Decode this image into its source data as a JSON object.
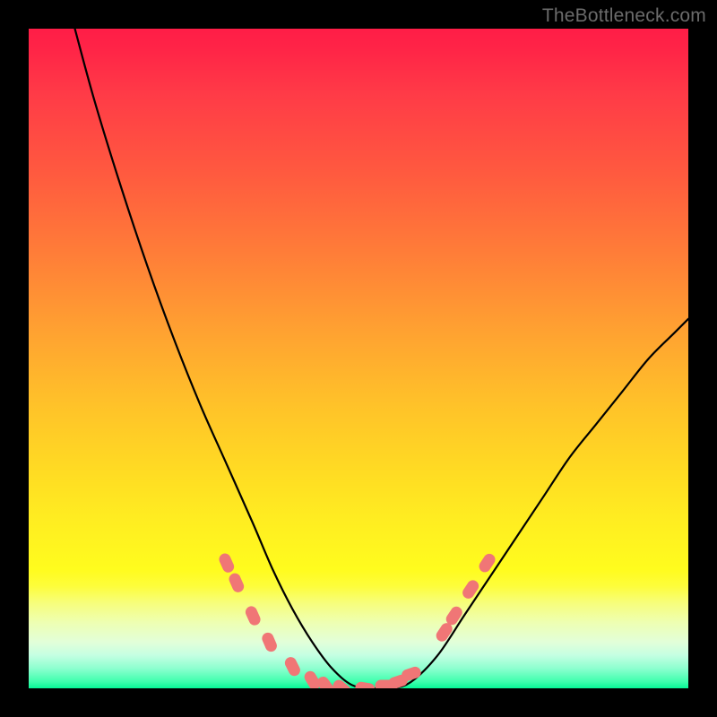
{
  "watermark": "TheBottleneck.com",
  "colors": {
    "curve": "#000000",
    "marker_fill": "#f07676",
    "marker_stroke": "#e86161",
    "gradient_top": "#ff1d47",
    "gradient_bottom": "#06f896",
    "frame": "#000000"
  },
  "chart_data": {
    "type": "line",
    "title": "",
    "xlabel": "",
    "ylabel": "",
    "xlim": [
      0,
      100
    ],
    "ylim": [
      0,
      100
    ],
    "grid": false,
    "note": "Axes are normalized 0–100; x moves left→right, y is 0 at top, 100 at bottom (green). The curve is a V-shaped bottleneck curve touching ~y=100 near x≈46–58.",
    "series": [
      {
        "name": "bottleneck-curve",
        "x": [
          7,
          10,
          14,
          18,
          22,
          26,
          30,
          34,
          37,
          40,
          43,
          46,
          49,
          52,
          55,
          58,
          62,
          66,
          70,
          74,
          78,
          82,
          86,
          90,
          94,
          98,
          100
        ],
        "y": [
          0,
          11,
          24,
          36,
          47,
          57,
          66,
          75,
          82,
          88,
          93,
          97,
          99.5,
          100,
          100,
          99,
          95,
          89,
          83,
          77,
          71,
          65,
          60,
          55,
          50,
          46,
          44
        ]
      }
    ],
    "markers": {
      "name": "highlight-points",
      "shape": "rounded-rect",
      "color": "#f07676",
      "x": [
        30,
        31.5,
        34,
        36.5,
        40,
        43,
        45,
        47.5,
        51,
        54,
        56,
        58,
        63,
        64.5,
        67,
        69.5
      ],
      "y": [
        81,
        84,
        89,
        93,
        96.7,
        98.8,
        99.6,
        100,
        100,
        99.6,
        99,
        97.8,
        91.5,
        89,
        85,
        81
      ]
    }
  }
}
